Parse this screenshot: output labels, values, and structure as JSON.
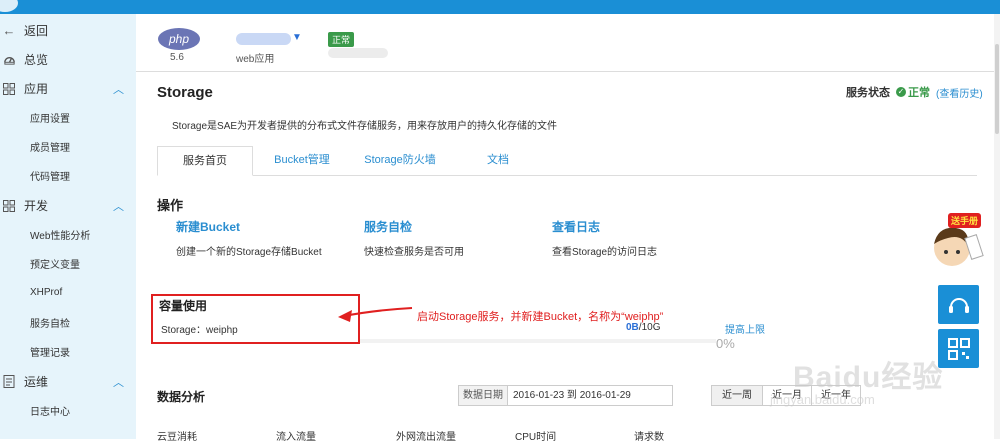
{
  "sidebar": {
    "back": "返回",
    "overview": "总览",
    "app_section": "应用",
    "app_items": [
      "应用设置",
      "成员管理",
      "代码管理"
    ],
    "dev_section": "开发",
    "dev_items": [
      "Web性能分析",
      "预定义变量",
      "XHProf",
      "服务自检",
      "管理记录"
    ],
    "ops_section": "运维",
    "ops_items": [
      "日志中心"
    ]
  },
  "app": {
    "php_label": "php",
    "php_version": "5.6",
    "type": "web应用",
    "status_tag": "正常"
  },
  "page": {
    "title": "Storage",
    "status_label": "服务状态",
    "status_value": "正常",
    "history_link": "(查看历史)",
    "description": "Storage是SAE为开发者提供的分布式文件存储服务，用来存放用户的持久化存储的文件"
  },
  "tabs": [
    "服务首页",
    "Bucket管理",
    "Storage防火墙",
    "文档"
  ],
  "operations": {
    "title": "操作",
    "items": [
      {
        "label": "新建Bucket",
        "desc": "创建一个新的Storage存储Bucket"
      },
      {
        "label": "服务自检",
        "desc": "快速检查服务是否可用"
      },
      {
        "label": "查看日志",
        "desc": "查看Storage的访问日志"
      }
    ]
  },
  "capacity": {
    "title": "容量使用",
    "line": "Storage：weiphp",
    "used": "0B",
    "total": "/10G",
    "raise_link": "提高上限",
    "percent": "0%",
    "annotation": "启动Storage服务，并新建Bucket，名称为“weiphp”"
  },
  "analytics": {
    "title": "数据分析",
    "date_label": "数据日期",
    "date_range": "2016-01-23 到 2016-01-29",
    "ranges": [
      "近一周",
      "近一月",
      "近一年"
    ],
    "columns": [
      "云豆消耗",
      "流入流量",
      "外网流出流量",
      "CPU时间",
      "请求数"
    ]
  },
  "widgets": {
    "mascot_tag": "送手册",
    "support_icon": "headset-icon",
    "qr_icon": "qrcode-icon"
  },
  "watermark": {
    "main": "Baidu经验",
    "sub": "jingyan.baidu.com"
  },
  "colors": {
    "accent": "#1a8fd6",
    "link": "#2a8ed0",
    "ok": "#3a9a4a",
    "annotation": "#e02020",
    "sidebar_bg": "#e6f4fb"
  }
}
